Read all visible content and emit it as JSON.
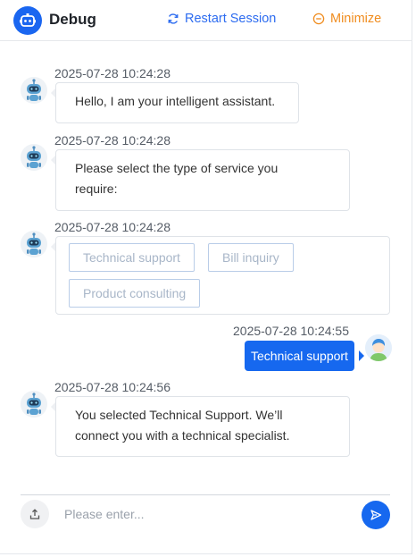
{
  "header": {
    "title": "Debug",
    "restart_label": "Restart Session",
    "minimize_label": "Minimize",
    "icons": [
      "robot-logo-icon",
      "refresh-icon",
      "minus-circle-icon"
    ]
  },
  "messages": [
    {
      "sender": "bot",
      "timestamp": "2025-07-28 10:24:28",
      "text": "Hello, I am your intelligent assistant."
    },
    {
      "sender": "bot",
      "timestamp": "2025-07-28 10:24:28",
      "text_lines": [
        "Please select the type of service you",
        "require:"
      ]
    },
    {
      "sender": "bot",
      "timestamp": "2025-07-28 10:24:28",
      "options": [
        "Technical support",
        "Bill inquiry",
        "Product consulting"
      ]
    },
    {
      "sender": "user",
      "timestamp": "2025-07-28 10:24:55",
      "text": "Technical support"
    },
    {
      "sender": "bot",
      "timestamp": "2025-07-28 10:24:56",
      "text_lines": [
        "You selected Technical Support. We’ll",
        "connect you with a technical specialist."
      ]
    }
  ],
  "composer": {
    "placeholder": "Please enter...",
    "icons": [
      "upload-icon",
      "send-icon"
    ]
  },
  "colors": {
    "accent": "#1668ef",
    "minimize": "#f08c1e",
    "option_border": "#b9cde8",
    "option_text": "#a8b6c8"
  }
}
